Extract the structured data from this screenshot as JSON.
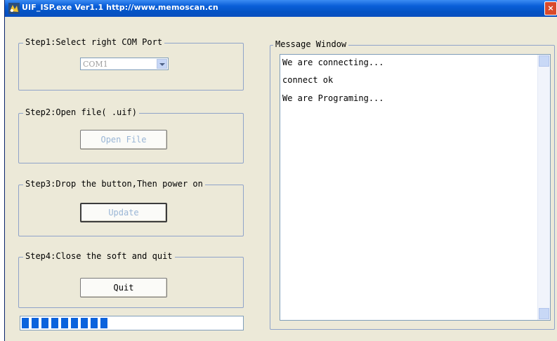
{
  "window": {
    "title": "UIF_ISP.exe  Ver1.1  http://www.memoscan.cn",
    "close_label": "×"
  },
  "step1": {
    "legend": "Step1:Select right COM Port",
    "com_port": "COM1"
  },
  "step2": {
    "legend": "Step2:Open file( .uif)",
    "button": "Open File"
  },
  "step3": {
    "legend": "Step3:Drop the button,Then power on",
    "button": "Update"
  },
  "step4": {
    "legend": "Step4:Close the soft and quit",
    "button": "Quit"
  },
  "progress": {
    "value_blocks": 9,
    "max_blocks": 31,
    "fraction": 0.29
  },
  "message_window": {
    "legend": "Message Window",
    "lines": [
      "We are connecting...",
      "connect ok",
      "We are Programing..."
    ]
  },
  "colors": {
    "titlebar": "#0a5fd8",
    "progress_fill": "#0b63dd",
    "window_bg": "#ECE9D8"
  }
}
